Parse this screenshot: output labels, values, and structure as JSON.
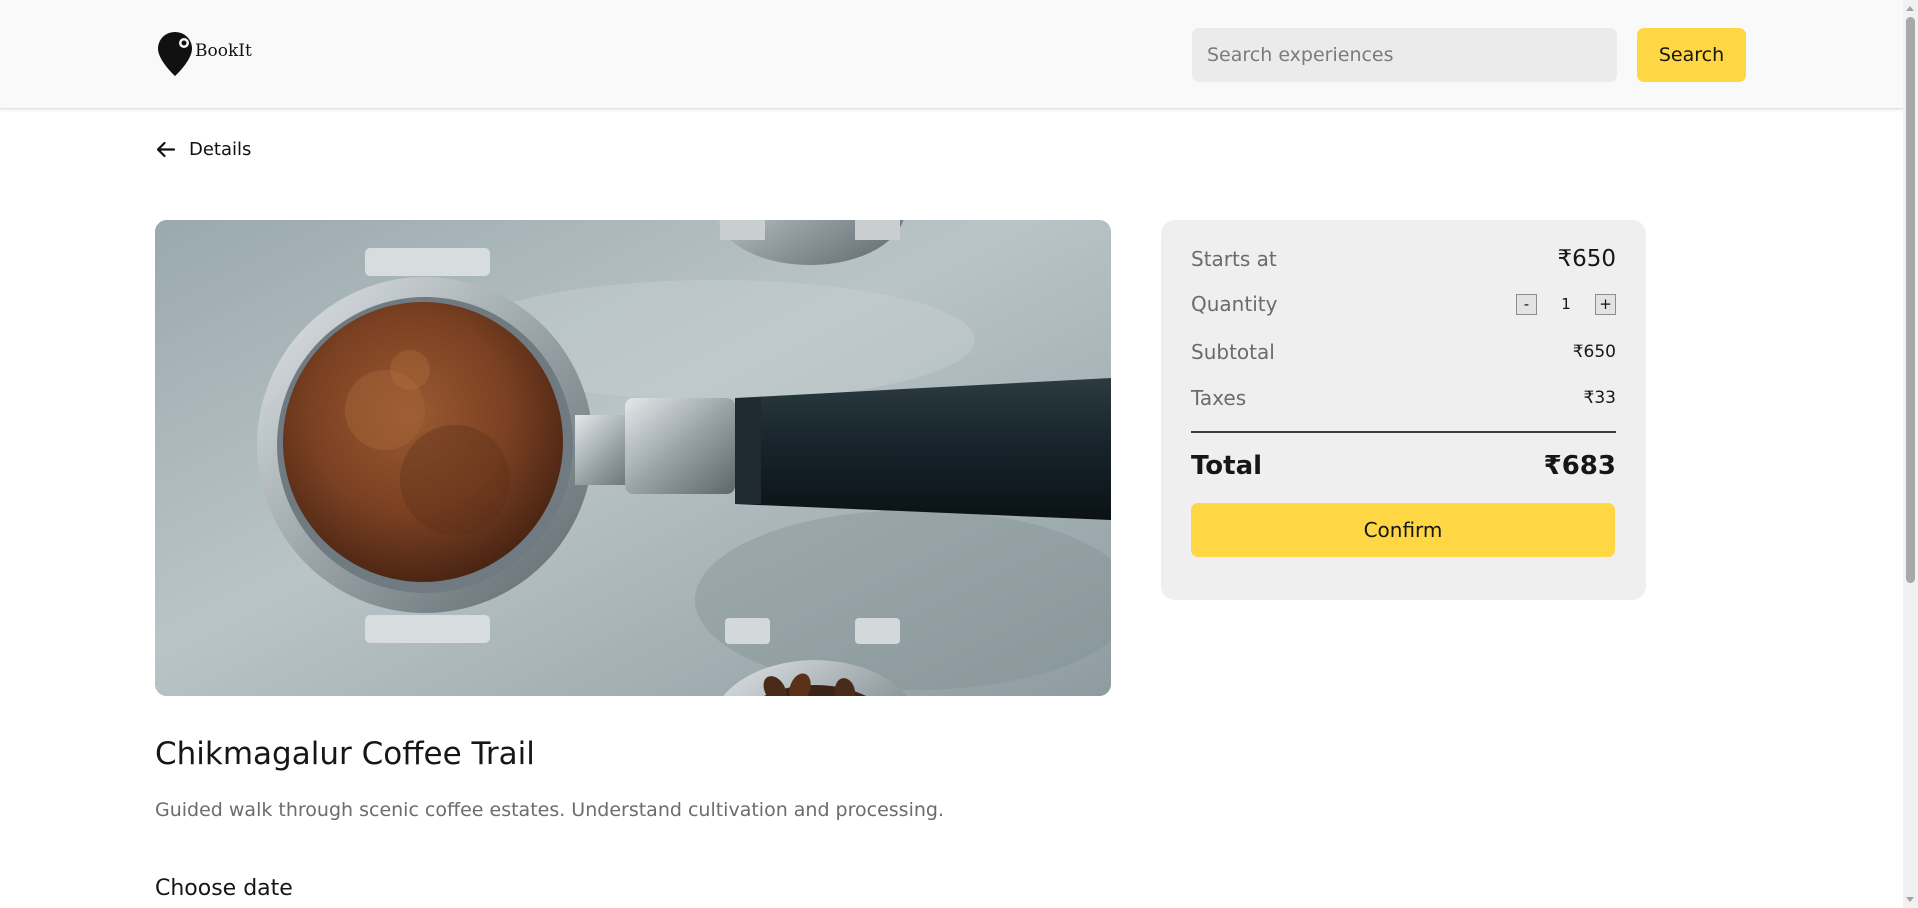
{
  "header": {
    "logo_text": "BookIt",
    "search_placeholder": "Search experiences",
    "search_button": "Search"
  },
  "nav": {
    "back_label": "Details"
  },
  "experience": {
    "title": "Chikmagalur Coffee Trail",
    "description": "Guided walk through scenic coffee estates. Understand cultivation and processing.",
    "choose_date_heading": "Choose date",
    "image": "espresso-portafilter-with-ground-coffee"
  },
  "pricing": {
    "starts_at_label": "Starts at",
    "starts_at_value": "₹650",
    "quantity_label": "Quantity",
    "quantity_decrement": "-",
    "quantity_value": "1",
    "quantity_increment": "+",
    "subtotal_label": "Subtotal",
    "subtotal_value": "₹650",
    "taxes_label": "Taxes",
    "taxes_value": "₹33",
    "total_label": "Total",
    "total_value": "₹683",
    "confirm_button": "Confirm"
  },
  "colors": {
    "accent": "#ffd643",
    "card_bg": "#efefef",
    "header_bg": "#f9f9f9",
    "input_bg": "#ebebeb"
  }
}
